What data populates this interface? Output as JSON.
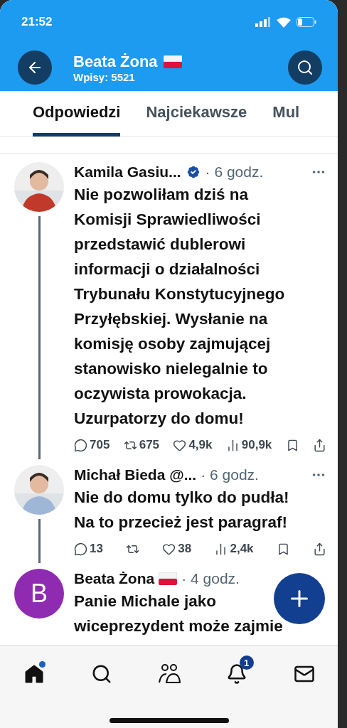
{
  "status_bar": {
    "time": "21:52"
  },
  "header": {
    "title": "Beata Żona",
    "subtitle": "Wpisy: 5521"
  },
  "tabs": [
    {
      "label": "Odpowiedzi",
      "selected": true
    },
    {
      "label": "Najciekawsze",
      "selected": false
    },
    {
      "label": "Mul",
      "selected": false
    }
  ],
  "posts": [
    {
      "author": "Kamila Gasiu...",
      "name_icons": [
        {
          "kind": "verified"
        }
      ],
      "time": "· 6 godz.",
      "text": "Nie pozwoliłam dziś na\nKomisji Sprawiedliwości\nprzedstawić dublerowi\ninformacji o działalności\nTrybunału Konstytucyjnego\nPrzyłębskiej. Wysłanie na\nkomisję osoby zajmującej\nstanowisko nielegalnie to\noczywista prowokacja.\nUzurpatorzy do domu!",
      "stats": [
        {
          "kind": "reply",
          "count": "705"
        },
        {
          "kind": "repost",
          "count": "675"
        },
        {
          "kind": "like",
          "count": "4,9k"
        },
        {
          "kind": "views",
          "count": "90,9k"
        },
        {
          "kind": "bookmark"
        },
        {
          "kind": "share"
        }
      ]
    },
    {
      "author": "Michał Bieda @...",
      "time": "· 6 godz.",
      "text": "Nie do domu tylko do pudła!\nNa to przecież jest paragraf!",
      "stats": [
        {
          "kind": "reply",
          "count": "13"
        },
        {
          "kind": "repost"
        },
        {
          "kind": "like",
          "count": "38"
        },
        {
          "kind": "views",
          "count": "2,4k"
        },
        {
          "kind": "bookmark"
        },
        {
          "kind": "share"
        }
      ]
    },
    {
      "avatar": {
        "kind": "letter",
        "letter": "B",
        "color": "#8e2bb0"
      },
      "author": "Beata Żona",
      "name_icons": [
        {
          "kind": "flag"
        }
      ],
      "time": "· 4 godz.",
      "text": "Panie Michale jako\nwiceprezydent może zajmie"
    }
  ],
  "bottom_nav": [
    {
      "kind": "home",
      "selected": true,
      "dot": true
    },
    {
      "kind": "search",
      "selected": false
    },
    {
      "kind": "people",
      "selected": false
    },
    {
      "kind": "bell",
      "selected": false,
      "badge": "1"
    },
    {
      "kind": "mail",
      "selected": false
    }
  ]
}
